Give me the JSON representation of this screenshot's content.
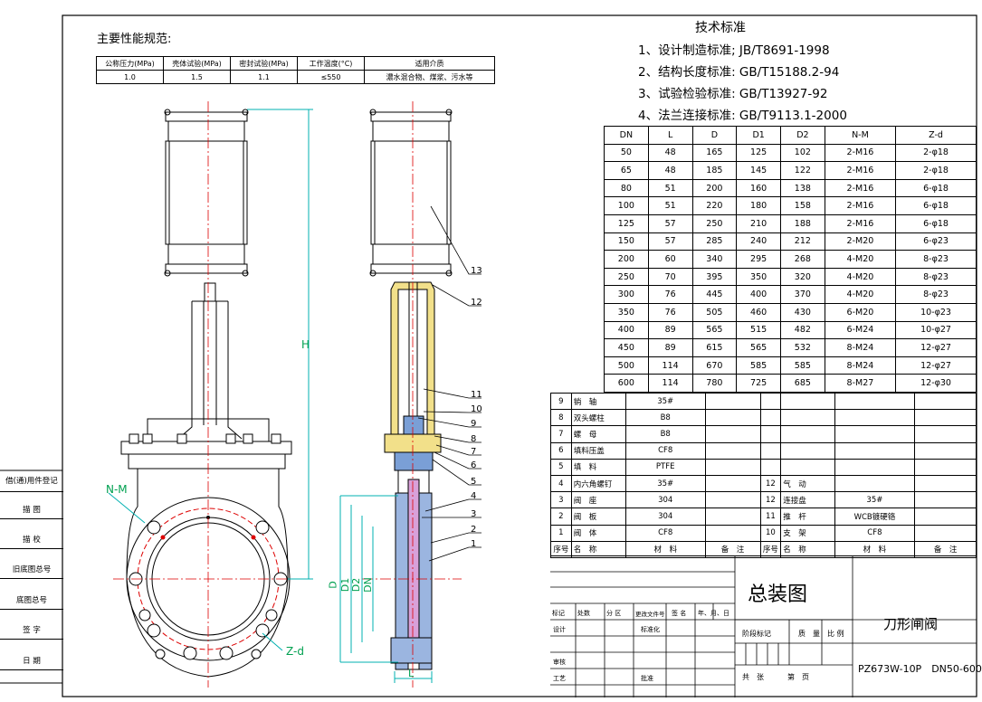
{
  "perf": {
    "title": "主要性能规范:",
    "headers": [
      "公称压力(MPa)",
      "壳体试验(MPa)",
      "密封试验(MPa)",
      "工作温度(°C)",
      "适用介质"
    ],
    "row": [
      "1.0",
      "1.5",
      "1.1",
      "≤550",
      "濃水混合物、煤浆、污水等"
    ]
  },
  "tech": {
    "title": "技术标准",
    "items": [
      "1、设计制造标准; JB/T8691-1998",
      "2、结构长度标准: GB/T15188.2-94",
      "3、试验检验标准: GB/T13927-92",
      "4、法兰连接标准: GB/T9113.1-2000"
    ]
  },
  "dims": {
    "headers": [
      "DN",
      "L",
      "D",
      "D1",
      "D2",
      "N-M",
      "Z-d"
    ],
    "rows": [
      [
        "50",
        "48",
        "165",
        "125",
        "102",
        "2-M16",
        "2-φ18"
      ],
      [
        "65",
        "48",
        "185",
        "145",
        "122",
        "2-M16",
        "2-φ18"
      ],
      [
        "80",
        "51",
        "200",
        "160",
        "138",
        "2-M16",
        "6-φ18"
      ],
      [
        "100",
        "51",
        "220",
        "180",
        "158",
        "2-M16",
        "6-φ18"
      ],
      [
        "125",
        "57",
        "250",
        "210",
        "188",
        "2-M16",
        "6-φ18"
      ],
      [
        "150",
        "57",
        "285",
        "240",
        "212",
        "2-M20",
        "6-φ23"
      ],
      [
        "200",
        "60",
        "340",
        "295",
        "268",
        "4-M20",
        "8-φ23"
      ],
      [
        "250",
        "70",
        "395",
        "350",
        "320",
        "4-M20",
        "8-φ23"
      ],
      [
        "300",
        "76",
        "445",
        "400",
        "370",
        "4-M20",
        "8-φ23"
      ],
      [
        "350",
        "76",
        "505",
        "460",
        "430",
        "6-M20",
        "10-φ23"
      ],
      [
        "400",
        "89",
        "565",
        "515",
        "482",
        "6-M24",
        "10-φ27"
      ],
      [
        "450",
        "89",
        "615",
        "565",
        "532",
        "8-M24",
        "12-φ27"
      ],
      [
        "500",
        "114",
        "670",
        "585",
        "585",
        "8-M24",
        "12-φ27"
      ],
      [
        "600",
        "114",
        "780",
        "725",
        "685",
        "8-M27",
        "12-φ30"
      ]
    ]
  },
  "parts": {
    "rows": [
      [
        "9",
        "销　轴",
        "35#",
        "",
        "",
        "",
        "",
        ""
      ],
      [
        "8",
        "双头螺柱",
        "B8",
        "",
        "",
        "",
        "",
        ""
      ],
      [
        "7",
        "螺　母",
        "B8",
        "",
        "",
        "",
        "",
        ""
      ],
      [
        "6",
        "填料压盖",
        "CF8",
        "",
        "",
        "",
        "",
        ""
      ],
      [
        "5",
        "填　料",
        "PTFE",
        "",
        "",
        "",
        "",
        ""
      ],
      [
        "4",
        "内六角螺钉",
        "35#",
        "",
        "12",
        "气　动",
        "",
        ""
      ],
      [
        "3",
        "阀　座",
        "304",
        "",
        "12",
        "连接盘",
        "35#",
        ""
      ],
      [
        "2",
        "阀　板",
        "304",
        "",
        "11",
        "推　杆",
        "WCB镀硬铬",
        ""
      ],
      [
        "1",
        "阀　体",
        "CF8",
        "",
        "10",
        "支　架",
        "CF8",
        ""
      ]
    ],
    "header": [
      "序号",
      "名　称",
      "材　料",
      "备　注",
      "序号",
      "名　称",
      "材　料",
      "备　注"
    ]
  },
  "titleblock": {
    "drawing_name": "总装图",
    "product": "刀形闸阀",
    "model": "PZ673W-10P　DN50-600",
    "rev_labels": [
      "标记",
      "处数",
      "分 区",
      "更改文件号",
      "签 名",
      "年、月、日"
    ],
    "sign_labels": [
      "设计",
      "标准化"
    ],
    "stage_labels": [
      "阶段标记",
      "质　量",
      "比 例"
    ],
    "check_labels": [
      "审核",
      "工艺",
      "批准"
    ],
    "sheet_labels": [
      "共　张",
      "第　页"
    ]
  },
  "side": [
    "借(通)用件登记",
    "描 图",
    "描 校",
    "旧底图总号",
    "底图总号",
    "签 字",
    "日 期"
  ],
  "labels": {
    "H": "H",
    "NM": "N-M",
    "Zd": "Z-d",
    "D": "D",
    "D1": "D1",
    "D2": "D2",
    "DN": "DN",
    "L": "L",
    "callouts": [
      "13",
      "12",
      "11",
      "10",
      "9",
      "8",
      "7",
      "6",
      "5",
      "4",
      "3",
      "2",
      "1"
    ]
  }
}
